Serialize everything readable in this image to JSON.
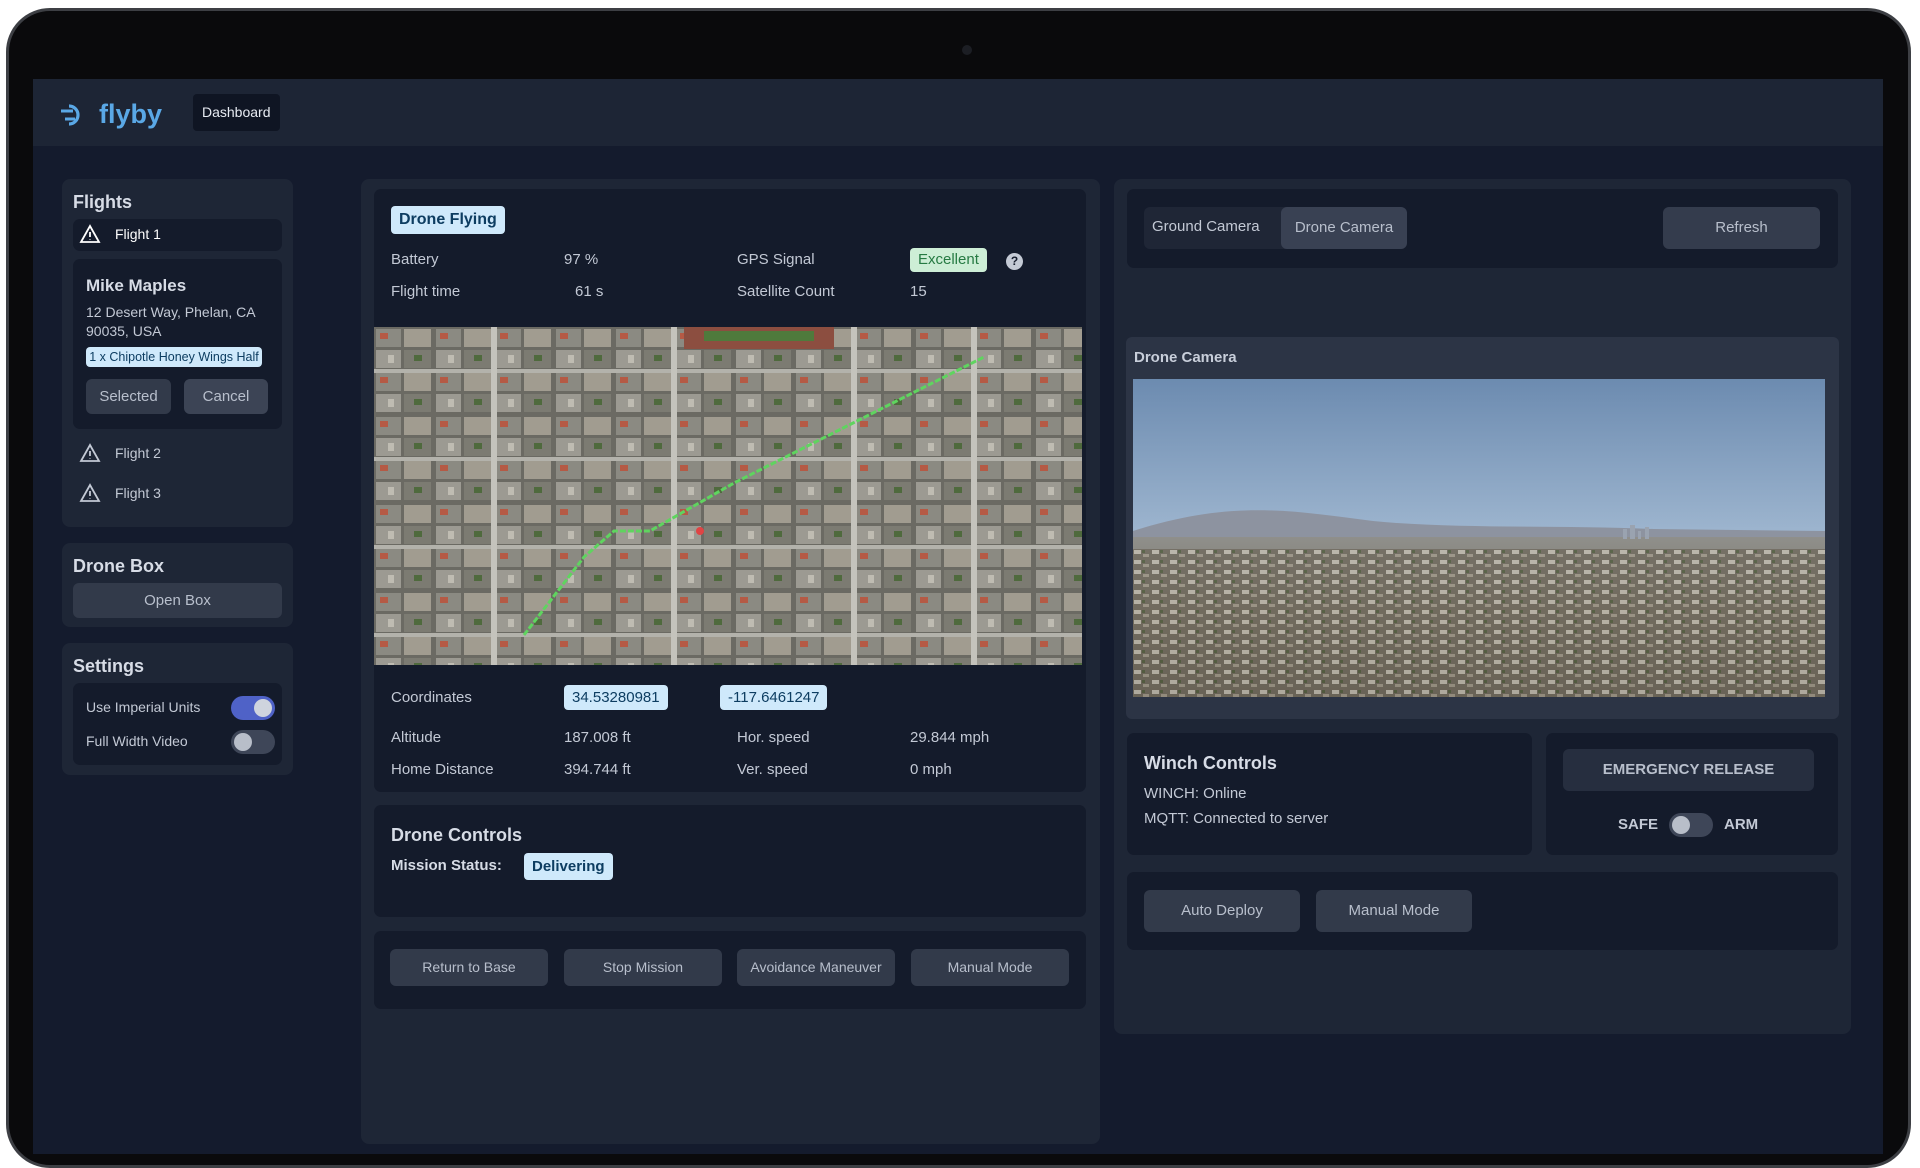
{
  "app": {
    "brand": "flyby",
    "nav_tab": "Dashboard"
  },
  "flights": {
    "title": "Flights",
    "items": [
      {
        "label": "Flight 1"
      },
      {
        "label": "Flight 2"
      },
      {
        "label": "Flight 3"
      }
    ],
    "selected_detail": {
      "customer": "Mike Maples",
      "address": "12 Desert Way, Phelan, CA 90035, USA",
      "order": "1 x Chipotle Honey Wings Half",
      "selected_label": "Selected",
      "cancel_label": "Cancel"
    }
  },
  "drone_box": {
    "title": "Drone Box",
    "open_label": "Open Box"
  },
  "settings": {
    "title": "Settings",
    "imperial_label": "Use Imperial Units",
    "imperial_on": true,
    "fullwidth_label": "Full Width Video",
    "fullwidth_on": false
  },
  "status": {
    "badge": "Drone Flying",
    "battery_label": "Battery",
    "battery_value": "97 %",
    "gps_label": "GPS Signal",
    "gps_value": "Excellent",
    "flighttime_label": "Flight time",
    "flighttime_value": "61 s",
    "satellite_label": "Satellite Count",
    "satellite_value": "15",
    "coordinates_label": "Coordinates",
    "lat": "34.53280981",
    "lon": "-117.6461247",
    "altitude_label": "Altitude",
    "altitude_value": "187.008 ft",
    "hspeed_label": "Hor. speed",
    "hspeed_value": "29.844 mph",
    "home_label": "Home Distance",
    "home_value": "394.744 ft",
    "vspeed_label": "Ver. speed",
    "vspeed_value": "0 mph"
  },
  "drone_controls": {
    "title": "Drone Controls",
    "mission_label": "Mission Status:",
    "mission_value": "Delivering",
    "buttons": [
      "Return to Base",
      "Stop Mission",
      "Avoidance Maneuver",
      "Manual Mode"
    ]
  },
  "camera": {
    "tabs": [
      "Ground Camera",
      "Drone Camera"
    ],
    "active_tab": "Drone Camera",
    "refresh_label": "Refresh",
    "feed_title": "Drone Camera"
  },
  "winch": {
    "title": "Winch Controls",
    "status": "WINCH: Online",
    "mqtt": "MQTT: Connected to server"
  },
  "emergency": {
    "release_label": "EMERGENCY RELEASE",
    "safe_label": "SAFE",
    "arm_label": "ARM",
    "armed": false
  },
  "deploy": {
    "auto_label": "Auto Deploy",
    "manual_label": "Manual Mode"
  },
  "colors": {
    "accent": "#5aa8e6",
    "badge_bg": "#cfe9fb",
    "good": "#cdeed6",
    "toggle_on": "#4f62c7"
  }
}
